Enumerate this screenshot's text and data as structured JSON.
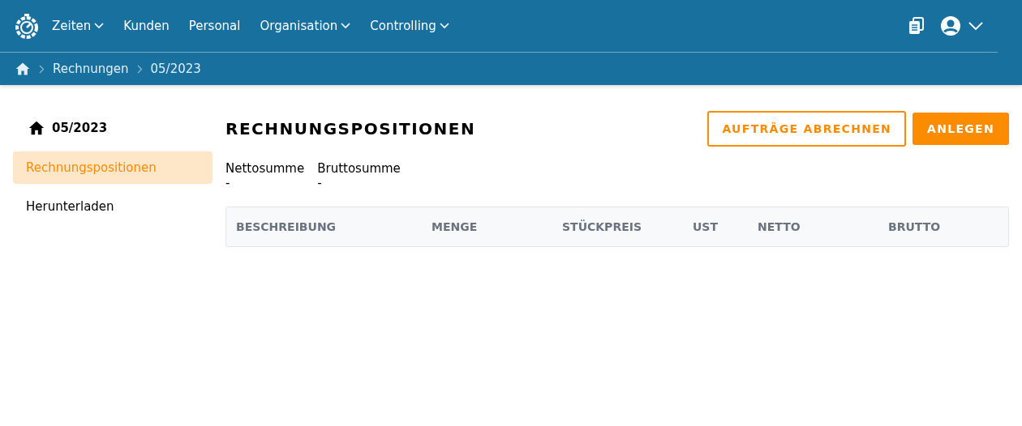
{
  "nav": [
    {
      "label": "Zeiten",
      "dropdown": true
    },
    {
      "label": "Kunden",
      "dropdown": false
    },
    {
      "label": "Personal",
      "dropdown": false
    },
    {
      "label": "Organisation",
      "dropdown": true
    },
    {
      "label": "Controlling",
      "dropdown": true
    }
  ],
  "breadcrumb": [
    "Rechnungen",
    "05/2023"
  ],
  "sidebar": {
    "title": "05/2023",
    "items": [
      {
        "label": "Rechnungspositionen",
        "selected": true
      },
      {
        "label": "Herunterladen",
        "selected": false
      }
    ]
  },
  "main": {
    "title": "RECHNUNGSPOSITIONEN",
    "buttons": [
      {
        "label": "AUFTRÄGE ABRECHNEN",
        "kind": "outline"
      },
      {
        "label": "ANLEGEN",
        "kind": "filled"
      }
    ],
    "summary": [
      {
        "label": "Nettosumme",
        "value": "-"
      },
      {
        "label": "Bruttosumme",
        "value": "-"
      }
    ],
    "table": {
      "columns": [
        "BESCHREIBUNG",
        "MENGE",
        "STÜCKPREIS",
        "UST",
        "NETTO",
        "BRUTTO"
      ]
    }
  }
}
